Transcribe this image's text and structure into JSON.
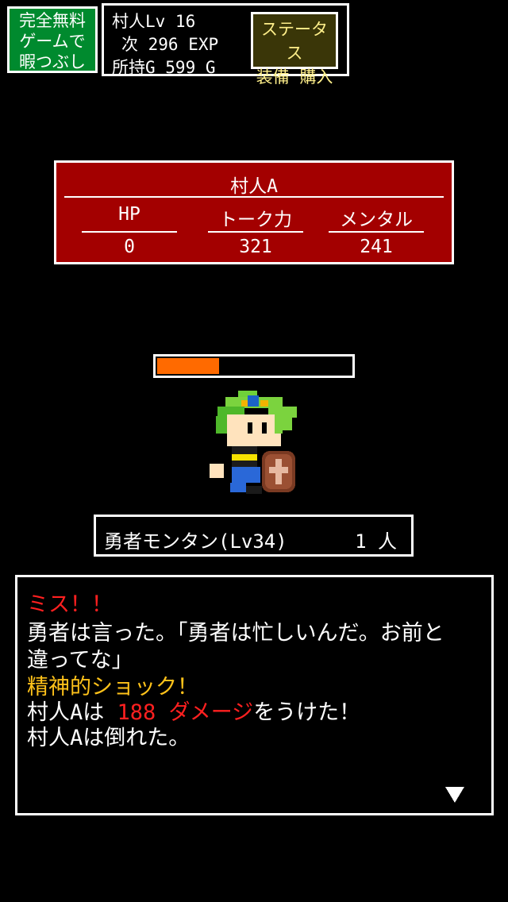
{
  "ad_banner": {
    "line1": "完全無料",
    "line2": "ゲームで",
    "line3": "暇つぶし"
  },
  "player": {
    "name_level": "村人Lv 16",
    "next_exp": "次 296 EXP",
    "gold": "所持G 599 G",
    "status_button": {
      "line1": "ステータス",
      "line2": "装備 購入"
    }
  },
  "enemy": {
    "name": "村人A",
    "stats": [
      {
        "label": "HP",
        "value": "0"
      },
      {
        "label": "トーク力",
        "value": "321"
      },
      {
        "label": "メンタル",
        "value": "241"
      }
    ]
  },
  "hero": {
    "hp_fraction": 0.32,
    "name": "勇者モンタン(Lv34)",
    "count": "1 人",
    "icon": "pixel-hero-with-shield-sprite"
  },
  "message": {
    "line1": "ミス！！",
    "line2": "勇者は言った。「勇者は忙しいんだ。お前と",
    "line3": "違ってな」",
    "line4": "精神的ショック！",
    "line5_a": "村人Aは ",
    "line5_b": "188 ダメージ",
    "line5_c": "をうけた！",
    "line6": "村人Aは倒れた。",
    "next_icon": "down-triangle-icon"
  },
  "colors": {
    "enemy_panel": "#a30000",
    "hp_fill": "#ff6a00",
    "ad": "#008a2e",
    "red_text": "#ff2020",
    "yellow_text": "#ffc21a"
  }
}
